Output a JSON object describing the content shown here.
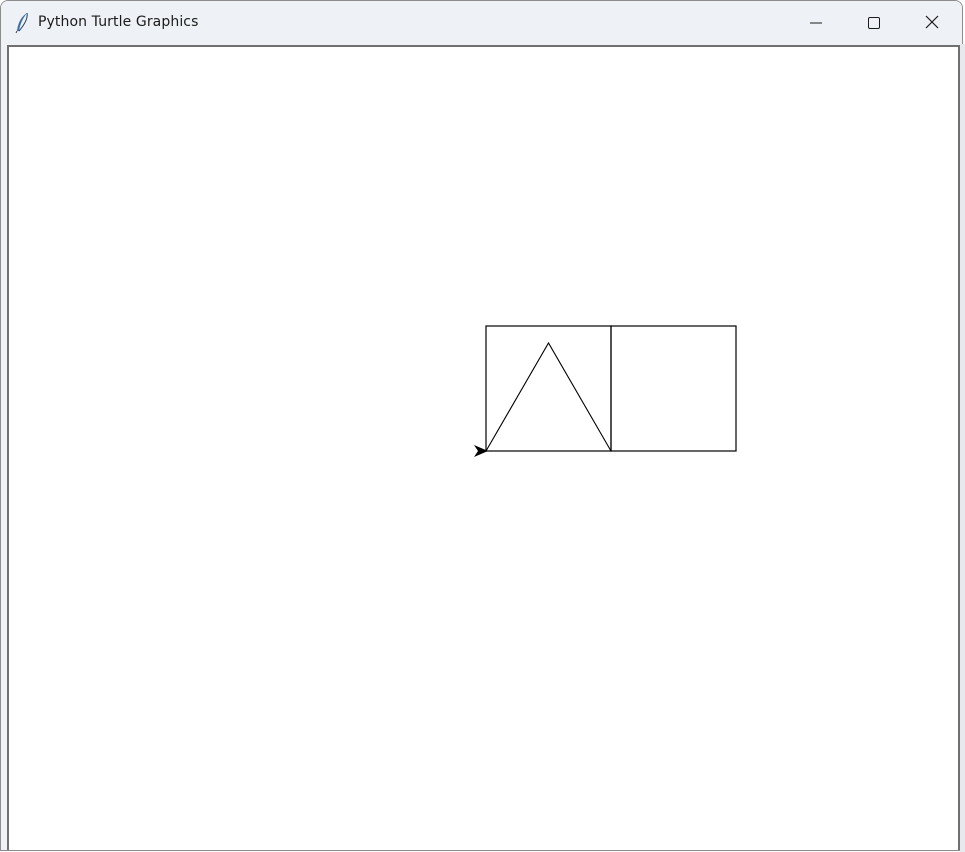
{
  "window": {
    "title": "Python Turtle Graphics",
    "app_icon": "feather-icon",
    "controls": {
      "minimize_icon": "minimize-icon",
      "maximize_icon": "maximize-icon",
      "close_icon": "close-icon"
    }
  },
  "canvas": {
    "background": "#ffffff",
    "stroke_color": "#000000",
    "drawing": {
      "shapes": [
        "square",
        "square",
        "triangle"
      ],
      "turtle_cursor": "arrow-cursor-icon"
    }
  }
}
